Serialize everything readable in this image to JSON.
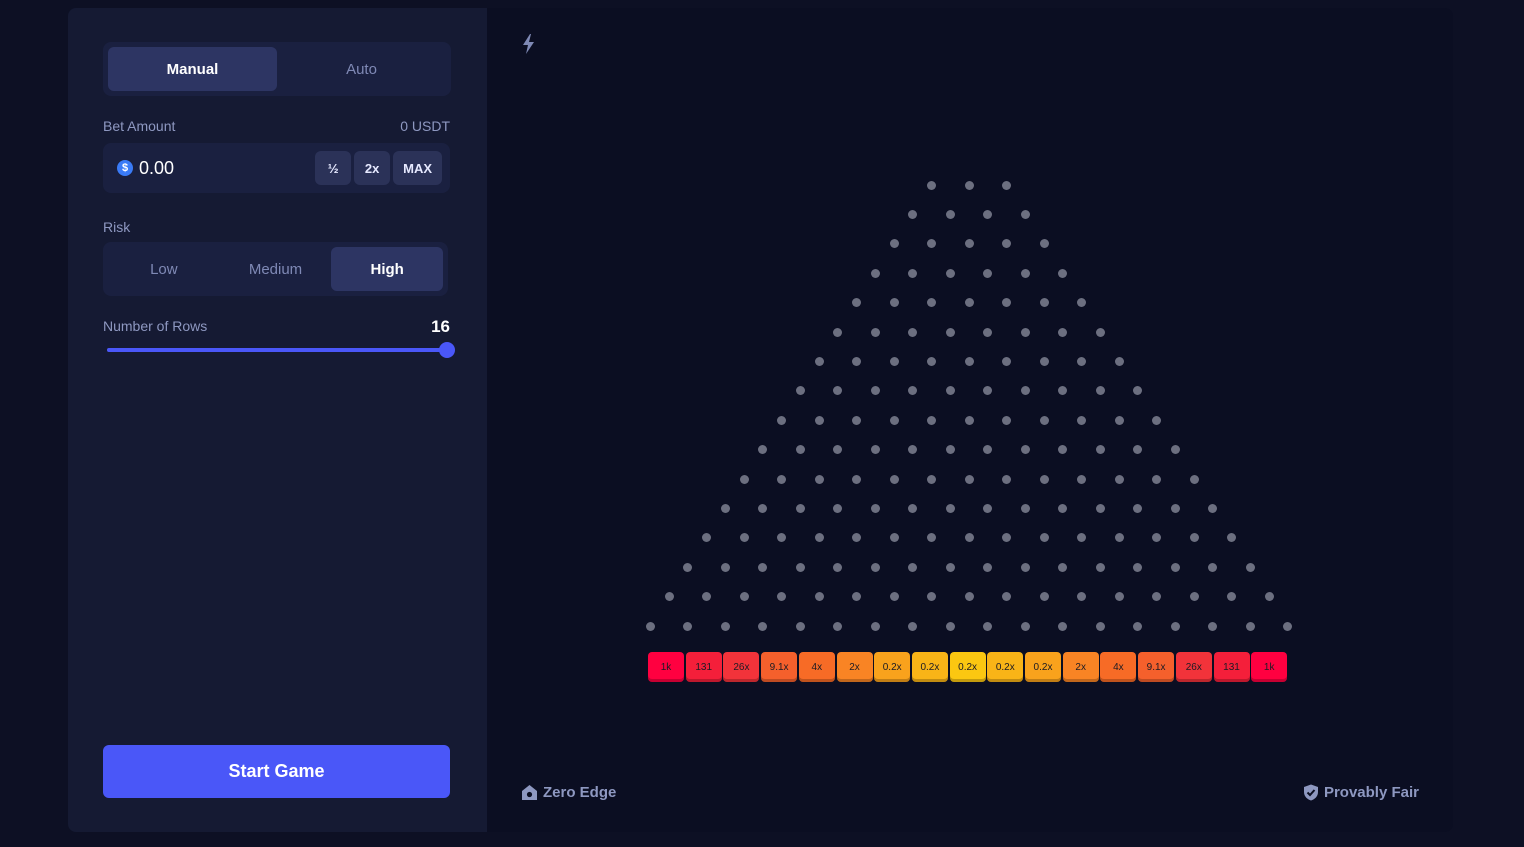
{
  "mode_tabs": [
    {
      "label": "Manual",
      "active": true
    },
    {
      "label": "Auto",
      "active": false
    }
  ],
  "bet": {
    "label": "Bet Amount",
    "balance": "0 USDT",
    "currency_symbol": "$",
    "value": "0.00",
    "half_label": "½",
    "double_label": "2x",
    "max_label": "MAX"
  },
  "risk": {
    "label": "Risk",
    "options": [
      {
        "label": "Low",
        "active": false
      },
      {
        "label": "Medium",
        "active": false
      },
      {
        "label": "High",
        "active": true
      }
    ]
  },
  "rows": {
    "label": "Number of Rows",
    "value": "16",
    "slider_fraction": 1.0
  },
  "start_label": "Start Game",
  "board": {
    "peg_rows": 16,
    "multipliers": [
      "1k",
      "131",
      "26x",
      "9.1x",
      "4x",
      "2x",
      "0.2x",
      "0.2x",
      "0.2x",
      "0.2x",
      "0.2x",
      "2x",
      "4x",
      "9.1x",
      "26x",
      "131",
      "1k"
    ],
    "bucket_colors": [
      "#ff0040",
      "#f41f3a",
      "#f2333a",
      "#f5602c",
      "#f76b26",
      "#f98424",
      "#f9a21c",
      "#f9b417",
      "#fbc711",
      "#f9b417",
      "#f9a21c",
      "#f98424",
      "#f76b26",
      "#f5602c",
      "#f2333a",
      "#f41f3a",
      "#ff0040"
    ]
  },
  "footer": {
    "zero_edge": "Zero Edge",
    "provably_fair": "Provably Fair"
  },
  "colors": {
    "accent": "#4a57f8",
    "panel": "#151a33",
    "stage": "#0b0e22"
  }
}
